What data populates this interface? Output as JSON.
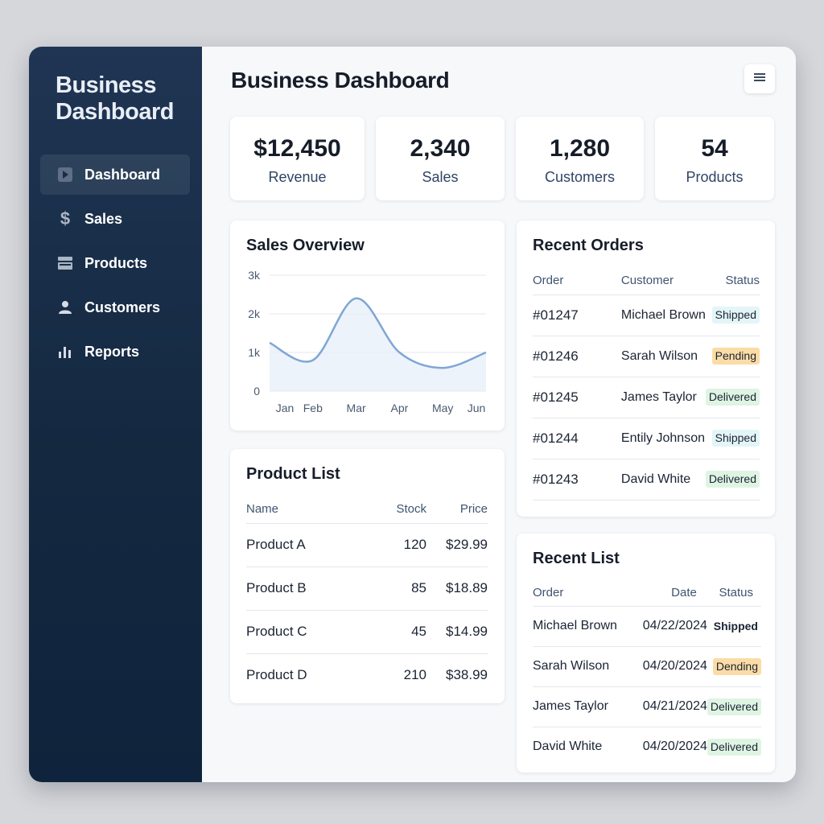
{
  "brand": {
    "line1": "Business",
    "line2": "Dashboard"
  },
  "sidebar": {
    "items": [
      {
        "label": "Dashboard",
        "icon": "play-square-icon",
        "active": true
      },
      {
        "label": "Sales",
        "icon": "dollar-icon",
        "active": false
      },
      {
        "label": "Products",
        "icon": "products-icon",
        "active": false
      },
      {
        "label": "Customers",
        "icon": "user-icon",
        "active": false
      },
      {
        "label": "Reports",
        "icon": "bar-chart-icon",
        "active": false
      }
    ]
  },
  "header": {
    "title": "Business Dashboard",
    "menu_icon": "hamburger-icon"
  },
  "stats": [
    {
      "value": "$12,450",
      "label": "Revenue"
    },
    {
      "value": "2,340",
      "label": "Sales"
    },
    {
      "value": "1,280",
      "label": "Customers"
    },
    {
      "value": "54",
      "label": "Products"
    }
  ],
  "sales_overview": {
    "title": "Sales Overview"
  },
  "chart_data": {
    "type": "area",
    "title": "Sales Overview",
    "categories": [
      "Jan",
      "Feb",
      "Mar",
      "Apr",
      "May",
      "Jun"
    ],
    "y_ticks": [
      "0",
      "1k",
      "2k",
      "3k"
    ],
    "ylim": [
      0,
      3000
    ],
    "series": [
      {
        "values": [
          1250,
          800,
          2400,
          1000,
          600,
          1000
        ]
      }
    ],
    "grid": true,
    "line_color": "#7fa6d4"
  },
  "products": {
    "title": "Product List",
    "columns": [
      "Name",
      "Stock",
      "Price"
    ],
    "rows": [
      [
        "Product A",
        "120",
        "$29.99"
      ],
      [
        "Product B",
        "85",
        "$18.89"
      ],
      [
        "Product C",
        "45",
        "$14.99"
      ],
      [
        "Product D",
        "210",
        "$38.99"
      ]
    ]
  },
  "orders": {
    "title": "Recent Orders",
    "columns": [
      "Order",
      "Customer",
      "Status"
    ],
    "rows": [
      [
        "#01247",
        "Michael Brown",
        "Shipped"
      ],
      [
        "#01246",
        "Sarah Wilson",
        "Pending"
      ],
      [
        "#01245",
        "James Taylor",
        "Delivered"
      ],
      [
        "#01244",
        "Entily Johnson",
        "Shipped"
      ],
      [
        "#01243",
        "David White",
        "Delivered"
      ]
    ]
  },
  "recent": {
    "title": "Recent List",
    "columns": [
      "Order",
      "Date",
      "Status"
    ],
    "rows": [
      [
        "Michael Brown",
        "04/22/2024",
        "Shipped"
      ],
      [
        "Sarah Wilson",
        "04/20/2024",
        "Dending"
      ],
      [
        "James Taylor",
        "04/21/2024",
        "Delivered"
      ],
      [
        "David White",
        "04/20/2024",
        "Delivered"
      ]
    ]
  },
  "colors": {
    "sidebar": "#142840",
    "accent": "#7fa6d4",
    "pending": "#fbdca6",
    "delivered": "#dff4e3",
    "shipped": "#e3f5f7"
  }
}
